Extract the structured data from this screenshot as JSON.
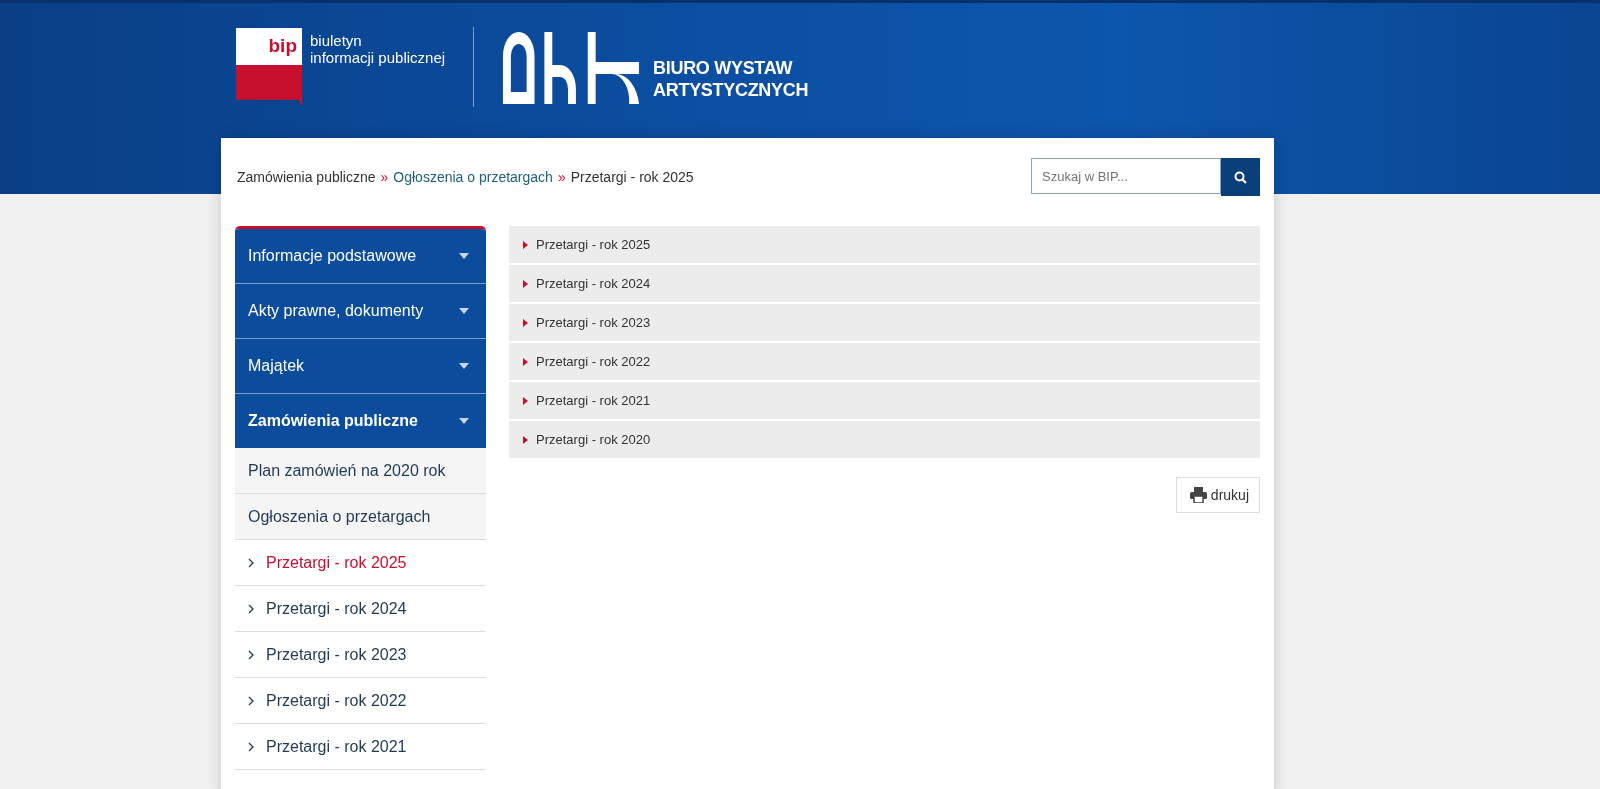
{
  "header": {
    "bip_logo": {
      "mark": "bip",
      "lines": [
        "biuletyn",
        "informacji publicznej"
      ]
    },
    "institution": {
      "lines": [
        "BIURO WYSTAW",
        "ARTYSTYCZNYCH"
      ]
    }
  },
  "breadcrumb": [
    {
      "label": "Zamówienia publiczne",
      "link": false,
      "separator": "»"
    },
    {
      "label": "Ogłoszenia o przetargach",
      "link": true,
      "separator": "»"
    },
    {
      "label": "Przetargi - rok 2025",
      "link": false
    }
  ],
  "search": {
    "placeholder": "Szukaj w BIP..."
  },
  "sidebar": [
    {
      "label": "Informacje podstawowe",
      "selected": false
    },
    {
      "label": "Akty prawne, dokumenty",
      "selected": false
    },
    {
      "label": "Majątek",
      "selected": false
    },
    {
      "label": "Zamówienia publiczne",
      "selected": true,
      "children": [
        {
          "label": "Plan zamówień na 2020 rok",
          "selected": false
        },
        {
          "label": "Ogłoszenia o przetargach",
          "selected": false,
          "children": [
            {
              "label": "Przetargi - rok 2025",
              "selected": true
            },
            {
              "label": "Przetargi - rok 2024",
              "selected": false
            },
            {
              "label": "Przetargi - rok 2023",
              "selected": false
            },
            {
              "label": "Przetargi - rok 2022",
              "selected": false
            },
            {
              "label": "Przetargi - rok 2021",
              "selected": false
            }
          ]
        }
      ]
    }
  ],
  "content_list": [
    "Przetargi - rok 2025",
    "Przetargi - rok 2024",
    "Przetargi - rok 2023",
    "Przetargi - rok 2022",
    "Przetargi - rok 2021",
    "Przetargi - rok 2020"
  ],
  "print_button": {
    "label": "drukuj"
  }
}
